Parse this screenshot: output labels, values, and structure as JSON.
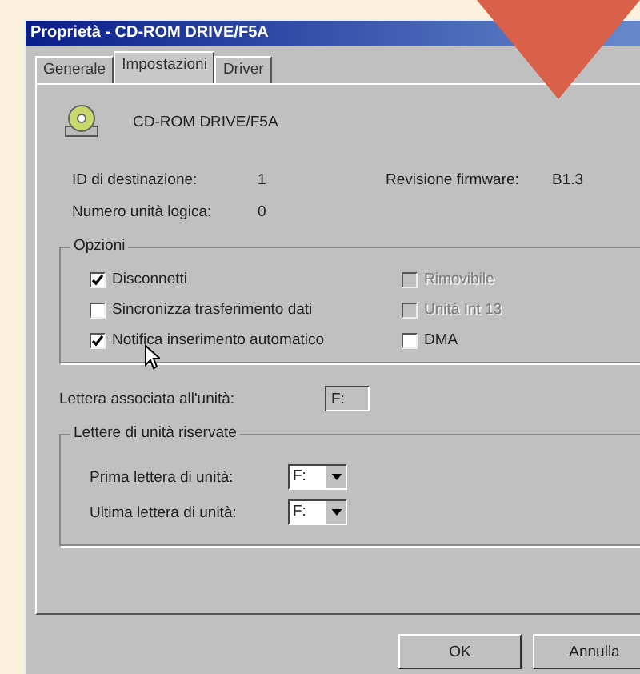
{
  "window": {
    "title": "Proprietà - CD-ROM DRIVE/F5A"
  },
  "tabs": [
    {
      "label": "Generale",
      "selected": false
    },
    {
      "label": "Impostazioni",
      "selected": true
    },
    {
      "label": "Driver",
      "selected": false
    }
  ],
  "device": {
    "name": "CD-ROM DRIVE/F5A"
  },
  "info": [
    {
      "label": "ID di destinazione:",
      "value": "1"
    },
    {
      "label": "Revisione firmware:",
      "value": "B1.3"
    },
    {
      "label": "Numero unità logica:",
      "value": "0"
    }
  ],
  "options": {
    "title": "Opzioni",
    "items": [
      {
        "label": "Disconnetti",
        "checked": true,
        "disabled": false
      },
      {
        "label": "Rimovibile",
        "checked": false,
        "disabled": true
      },
      {
        "label": "Sincronizza trasferimento dati",
        "checked": false,
        "disabled": false
      },
      {
        "label": "Unità Int 13",
        "checked": false,
        "disabled": true
      },
      {
        "label": "Notifica inserimento automatico",
        "checked": true,
        "disabled": false
      },
      {
        "label": "DMA",
        "checked": false,
        "disabled": false
      }
    ]
  },
  "drive_letter": {
    "label": "Lettera associata all'unità:",
    "value": "F:"
  },
  "reserved": {
    "title": "Lettere di unità riservate",
    "rows": [
      {
        "label": "Prima lettera di unità:",
        "value": "F:"
      },
      {
        "label": "Ultima lettera di unità:",
        "value": "F:"
      }
    ]
  },
  "buttons": [
    "OK",
    "Annulla"
  ]
}
